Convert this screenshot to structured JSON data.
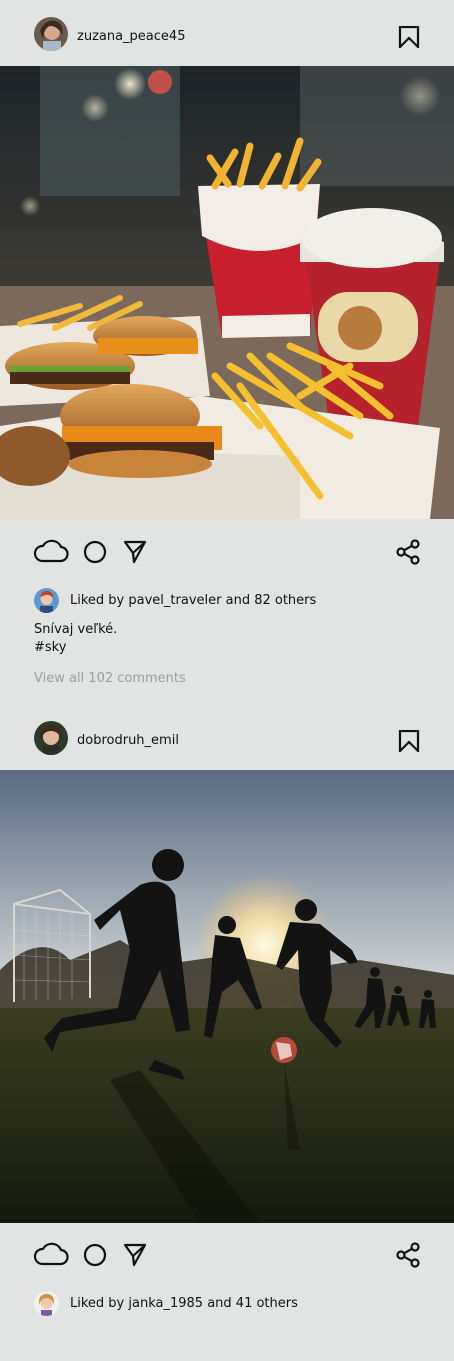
{
  "posts": [
    {
      "username": "zuzana_peace45",
      "avatar_icon": "user-avatar",
      "bookmark_icon": "bookmark-icon",
      "image_description_icon": "fast-food-photo",
      "actions": {
        "like_icon": "cloud-icon",
        "comment_icon": "circle-icon",
        "send_icon": "send-icon",
        "share_icon": "share-icon"
      },
      "likes": {
        "prefix": "Liked by",
        "user": "pavel_traveler",
        "suffix": "and 82 others"
      },
      "caption_line1": "Snívaj veľké.",
      "caption_line2": "#sky",
      "view_comments": "View all 102 comments"
    },
    {
      "username": "dobrodruh_emil",
      "avatar_icon": "user-avatar",
      "bookmark_icon": "bookmark-icon",
      "image_description_icon": "soccer-photo",
      "actions": {
        "like_icon": "cloud-icon",
        "comment_icon": "circle-icon",
        "send_icon": "send-icon",
        "share_icon": "share-icon"
      },
      "likes": {
        "prefix": "Liked by",
        "user": "janka_1985",
        "suffix": "and 41 others"
      }
    }
  ],
  "colors": {
    "background": "#e1e4e3",
    "text": "#111111",
    "muted": "#9aa0a0"
  }
}
